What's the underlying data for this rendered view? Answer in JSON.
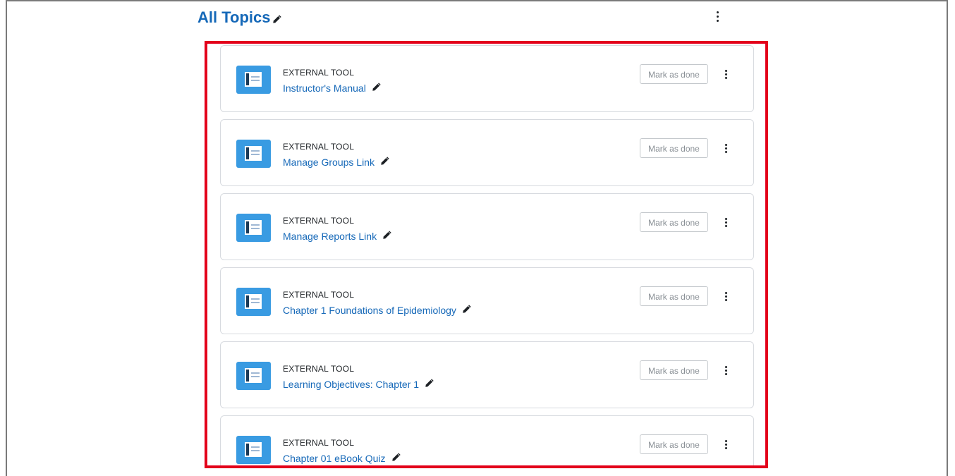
{
  "section": {
    "title": "All Topics",
    "edit_icon": "pencil-icon",
    "menu_icon": "kebab-menu-icon"
  },
  "activities": [
    {
      "type": "EXTERNAL TOOL",
      "title": "Instructor's Manual",
      "action_label": "Mark as done"
    },
    {
      "type": "EXTERNAL TOOL",
      "title": "Manage Groups Link",
      "action_label": "Mark as done"
    },
    {
      "type": "EXTERNAL TOOL",
      "title": "Manage Reports Link",
      "action_label": "Mark as done"
    },
    {
      "type": "EXTERNAL TOOL",
      "title": "Chapter 1 Foundations of Epidemiology",
      "action_label": "Mark as done"
    },
    {
      "type": "EXTERNAL TOOL",
      "title": "Learning Objectives: Chapter 1",
      "action_label": "Mark as done"
    },
    {
      "type": "EXTERNAL TOOL",
      "title": "Chapter 01 eBook Quiz",
      "action_label": "Mark as done"
    }
  ],
  "colors": {
    "link": "#1568b8",
    "icon_bg": "#399be2",
    "highlight_border": "#e3001b"
  }
}
